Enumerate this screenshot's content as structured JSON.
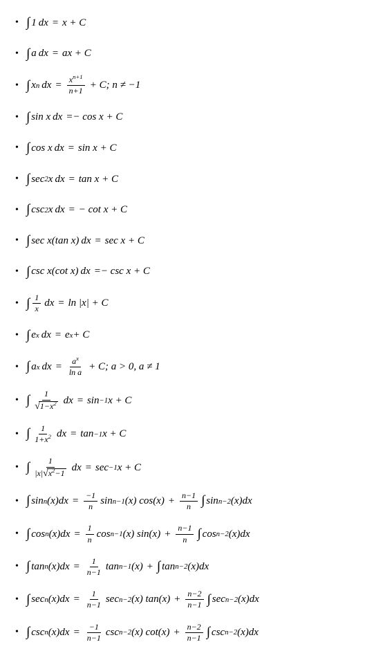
{
  "formulas": [
    {
      "type": "basic",
      "integrand": "1",
      "result": "x + C"
    },
    {
      "type": "basic",
      "integrand": "a",
      "result": "ax + C"
    },
    {
      "type": "power",
      "integrand": "x",
      "exp": "n",
      "result_frac": {
        "num": "x",
        "num_exp": "n+1",
        "den": "n+1"
      },
      "cond": "; n ≠ −1"
    },
    {
      "type": "trig",
      "integrand": "sin x",
      "result": "− cos x + C"
    },
    {
      "type": "trig",
      "integrand": "cos x",
      "result": "sin x + C"
    },
    {
      "type": "trig",
      "integrand": "sec",
      "exp": "2",
      "arg": " x",
      "result": "tan x + C"
    },
    {
      "type": "trig",
      "integrand": "csc",
      "exp": "2",
      "arg": " x",
      "result": "− cot x + C"
    },
    {
      "type": "trig",
      "integrand": "sec x(tan x)",
      "result": "sec x + C"
    },
    {
      "type": "trig",
      "integrand": "csc x(cot x)",
      "result": "− csc x + C"
    },
    {
      "type": "fracint",
      "frac": {
        "num": "1",
        "den": "x"
      },
      "result": "ln |x| + C"
    },
    {
      "type": "exp",
      "integrand": "e",
      "exp": "x",
      "result": "e",
      "result_exp": "x",
      "tail": " + C"
    },
    {
      "type": "expA",
      "integrand": "a",
      "exp": "x",
      "result_frac": {
        "num": "a",
        "num_exp": "x",
        "den": "ln a"
      },
      "cond": "; a > 0, a ≠ 1"
    },
    {
      "type": "inv1",
      "den_sqrt": "1−x",
      "den_sqrt_exp": "2",
      "result": "sin",
      "result_exp": "−1",
      "arg": " x + C"
    },
    {
      "type": "inv2",
      "den": "1+x",
      "den_exp": "2",
      "result": "tan",
      "result_exp": "−1",
      "arg": " x + C"
    },
    {
      "type": "inv3",
      "den_pre": "|x|",
      "den_sqrt": "x",
      "den_sqrt_exp": "2",
      "den_sqrt_tail": "−1",
      "result": "sec",
      "result_exp": "−1",
      "arg": " x + C"
    },
    {
      "type": "reduce",
      "fn": "sin",
      "coef_frac": {
        "num": "−1",
        "den": "n"
      },
      "mid": "sin",
      "mid_exp": "n−1",
      "mid_arg": "(x) cos(x)",
      "plus_frac": {
        "num": "n−1",
        "den": "n"
      },
      "tail_fn": "sin",
      "tail_exp": "n−2"
    },
    {
      "type": "reduce",
      "fn": "cos",
      "coef_frac": {
        "num": "1",
        "den": "n"
      },
      "mid": "cos",
      "mid_exp": "n−1",
      "mid_arg": "(x) sin(x)",
      "plus_frac": {
        "num": "n−1",
        "den": "n"
      },
      "tail_fn": "cos",
      "tail_exp": "n−2"
    },
    {
      "type": "reduceTan",
      "fn": "tan",
      "coef_frac": {
        "num": "1",
        "den": "n−1"
      },
      "mid": "tan",
      "mid_exp": "n−1",
      "mid_arg": "(x)",
      "tail_fn": "tan",
      "tail_exp": "n−2"
    },
    {
      "type": "reduce",
      "fn": "sec",
      "coef_frac": {
        "num": "1",
        "den": "n−1"
      },
      "mid": "sec",
      "mid_exp": "n−2",
      "mid_arg": "(x) tan(x)",
      "plus_frac": {
        "num": "n−2",
        "den": "n−1"
      },
      "tail_fn": "sec",
      "tail_exp": "n−2"
    },
    {
      "type": "reduce",
      "fn": "csc",
      "coef_frac": {
        "num": "−1",
        "den": "n−1"
      },
      "mid": "csc",
      "mid_exp": "n−2",
      "mid_arg": "(x) cot(x)",
      "plus_frac": {
        "num": "n−2",
        "den": "n−1"
      },
      "tail_fn": "csc",
      "tail_exp": "n−2"
    }
  ]
}
